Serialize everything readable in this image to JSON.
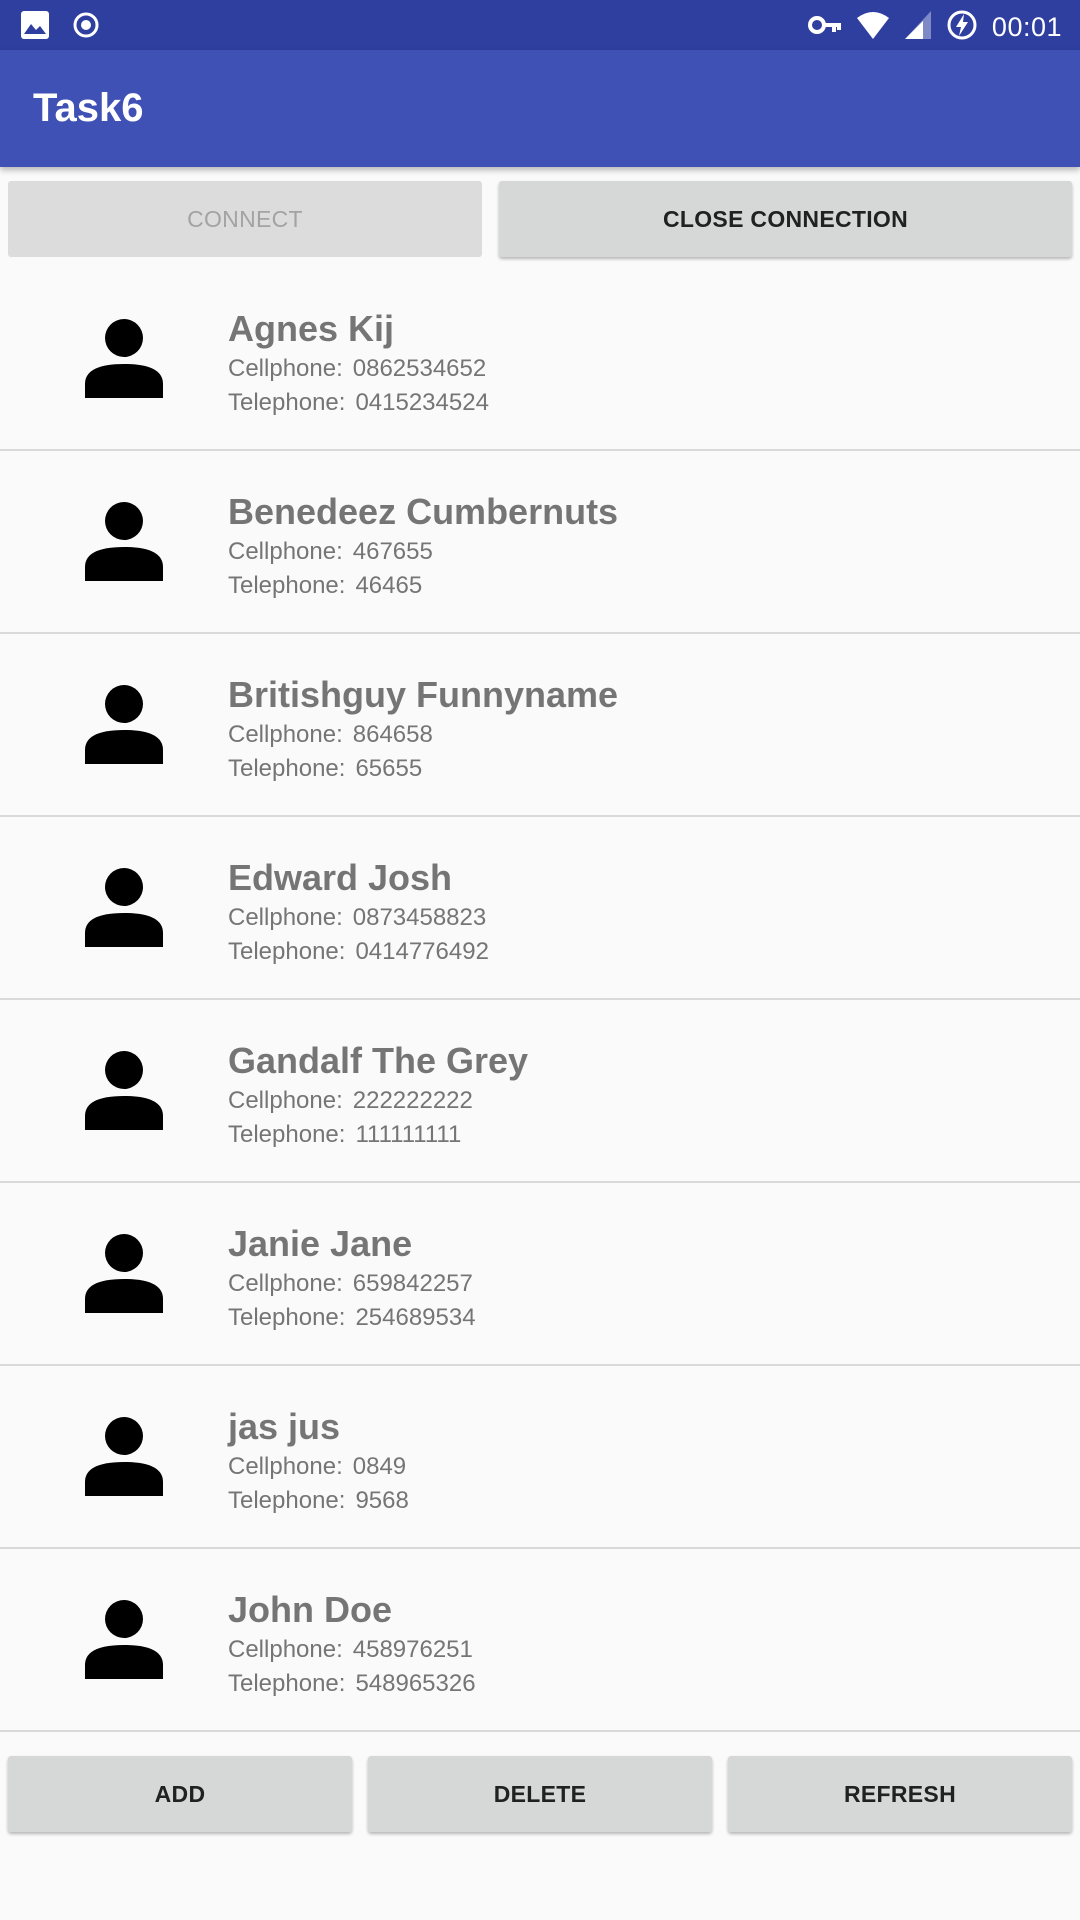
{
  "status_bar": {
    "time": "00:01",
    "left_icons": [
      "image-icon",
      "record-icon"
    ],
    "right_icons": [
      "key-icon",
      "wifi-icon",
      "signal-icon",
      "battery-charging-icon"
    ],
    "background": "#2f3f9f"
  },
  "app_bar": {
    "title": "Task6",
    "background": "#3f51b5"
  },
  "top_buttons": {
    "connect_label": "CONNECT",
    "connect_enabled": false,
    "close_label": "CLOSE CONNECTION"
  },
  "contacts": [
    {
      "name": "Agnes Kij",
      "cell_label": "Cellphone:",
      "cell": "0862534652",
      "tel_label": "Telephone:",
      "tel": "0415234524"
    },
    {
      "name": "Benedeez Cumbernuts",
      "cell_label": "Cellphone:",
      "cell": "467655",
      "tel_label": "Telephone:",
      "tel": "46465"
    },
    {
      "name": "Britishguy Funnyname",
      "cell_label": "Cellphone:",
      "cell": "864658",
      "tel_label": "Telephone:",
      "tel": "65655"
    },
    {
      "name": "Edward Josh",
      "cell_label": "Cellphone:",
      "cell": "0873458823",
      "tel_label": "Telephone:",
      "tel": "0414776492"
    },
    {
      "name": "Gandalf The Grey",
      "cell_label": "Cellphone:",
      "cell": "222222222",
      "tel_label": "Telephone:",
      "tel": "111111111"
    },
    {
      "name": "Janie Jane",
      "cell_label": "Cellphone:",
      "cell": "659842257",
      "tel_label": "Telephone:",
      "tel": "254689534"
    },
    {
      "name": "jas jus",
      "cell_label": "Cellphone:",
      "cell": "0849",
      "tel_label": "Telephone:",
      "tel": "9568"
    },
    {
      "name": "John Doe",
      "cell_label": "Cellphone:",
      "cell": "458976251",
      "tel_label": "Telephone:",
      "tel": "548965326"
    }
  ],
  "contact_icon": "person-icon",
  "bottom_buttons": {
    "add_label": "ADD",
    "delete_label": "DELETE",
    "refresh_label": "REFRESH"
  }
}
